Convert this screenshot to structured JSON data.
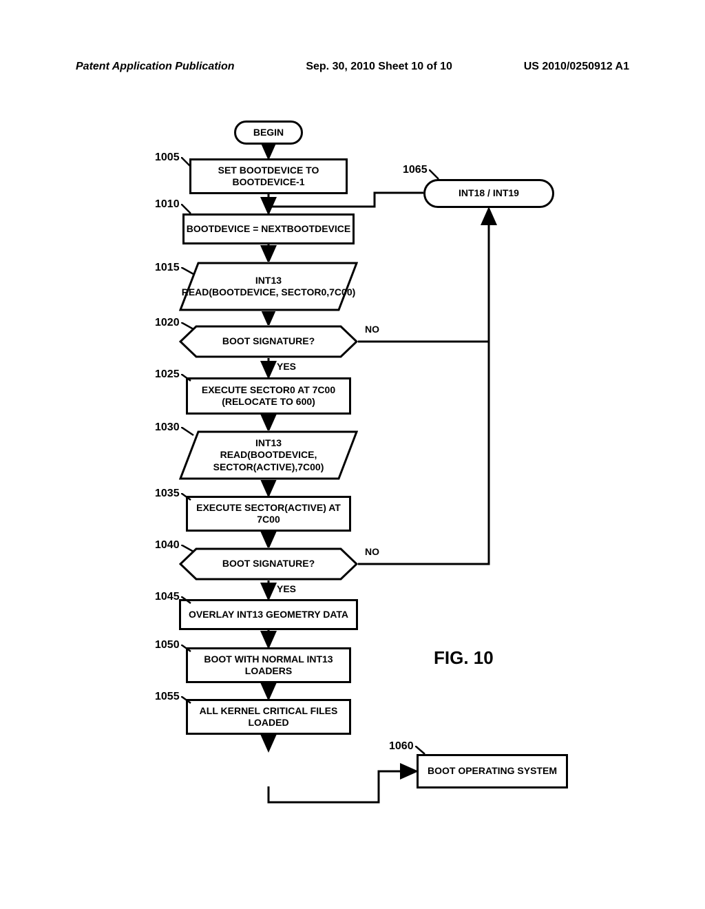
{
  "header": {
    "left": "Patent Application Publication",
    "center": "Sep. 30, 2010  Sheet 10 of 10",
    "right": "US 2010/0250912 A1"
  },
  "figure_label": "FIG. 10",
  "nodes": {
    "begin": "BEGIN",
    "n1005": "SET BOOTDEVICE TO BOOTDEVICE-1",
    "n1010": "BOOTDEVICE = NEXTBOOTDEVICE",
    "n1015": "INT13\nREAD(BOOTDEVICE, SECTOR0,7C00)",
    "n1020": "BOOT SIGNATURE?",
    "n1025": "EXECUTE SECTOR0 AT 7C00 (RELOCATE TO 600)",
    "n1030": "INT13\nREAD(BOOTDEVICE, SECTOR(ACTIVE),7C00)",
    "n1035": "EXECUTE SECTOR(ACTIVE) AT 7C00",
    "n1040": "BOOT SIGNATURE?",
    "n1045": "OVERLAY INT13 GEOMETRY DATA",
    "n1050": "BOOT WITH NORMAL INT13 LOADERS",
    "n1055": "ALL KERNEL CRITICAL FILES LOADED",
    "n1060": "BOOT OPERATING SYSTEM",
    "n1065": "INT18 / INT19"
  },
  "refs": {
    "r1005": "1005",
    "r1010": "1010",
    "r1015": "1015",
    "r1020": "1020",
    "r1025": "1025",
    "r1030": "1030",
    "r1035": "1035",
    "r1040": "1040",
    "r1045": "1045",
    "r1050": "1050",
    "r1055": "1055",
    "r1060": "1060",
    "r1065": "1065"
  },
  "edges": {
    "yes": "YES",
    "no": "NO"
  }
}
